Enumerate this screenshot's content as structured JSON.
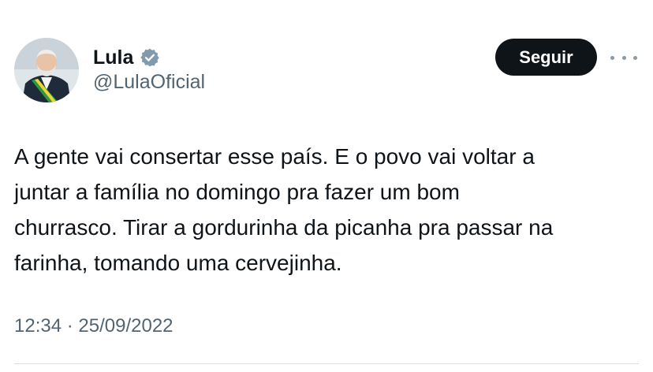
{
  "author": {
    "display_name": "Lula",
    "handle": "@LulaOficial",
    "verified_icon": "verified-badge-icon",
    "verified_color": "#829aab"
  },
  "actions": {
    "follow_label": "Seguir",
    "more_icon": "more-options-icon"
  },
  "tweet": {
    "lines": [
      "A gente vai consertar esse país. E o povo vai voltar a",
      "juntar a família no domingo pra fazer um bom",
      "churrasco. Tirar a gordurinha da picanha pra passar na",
      "farinha, tomando uma cervejinha."
    ]
  },
  "meta": {
    "time": "12:34",
    "separator": " · ",
    "date": "25/09/2022"
  },
  "colors": {
    "text": "#0f1419",
    "secondary": "#536471",
    "button_bg": "#0f1419",
    "button_text": "#ffffff"
  }
}
